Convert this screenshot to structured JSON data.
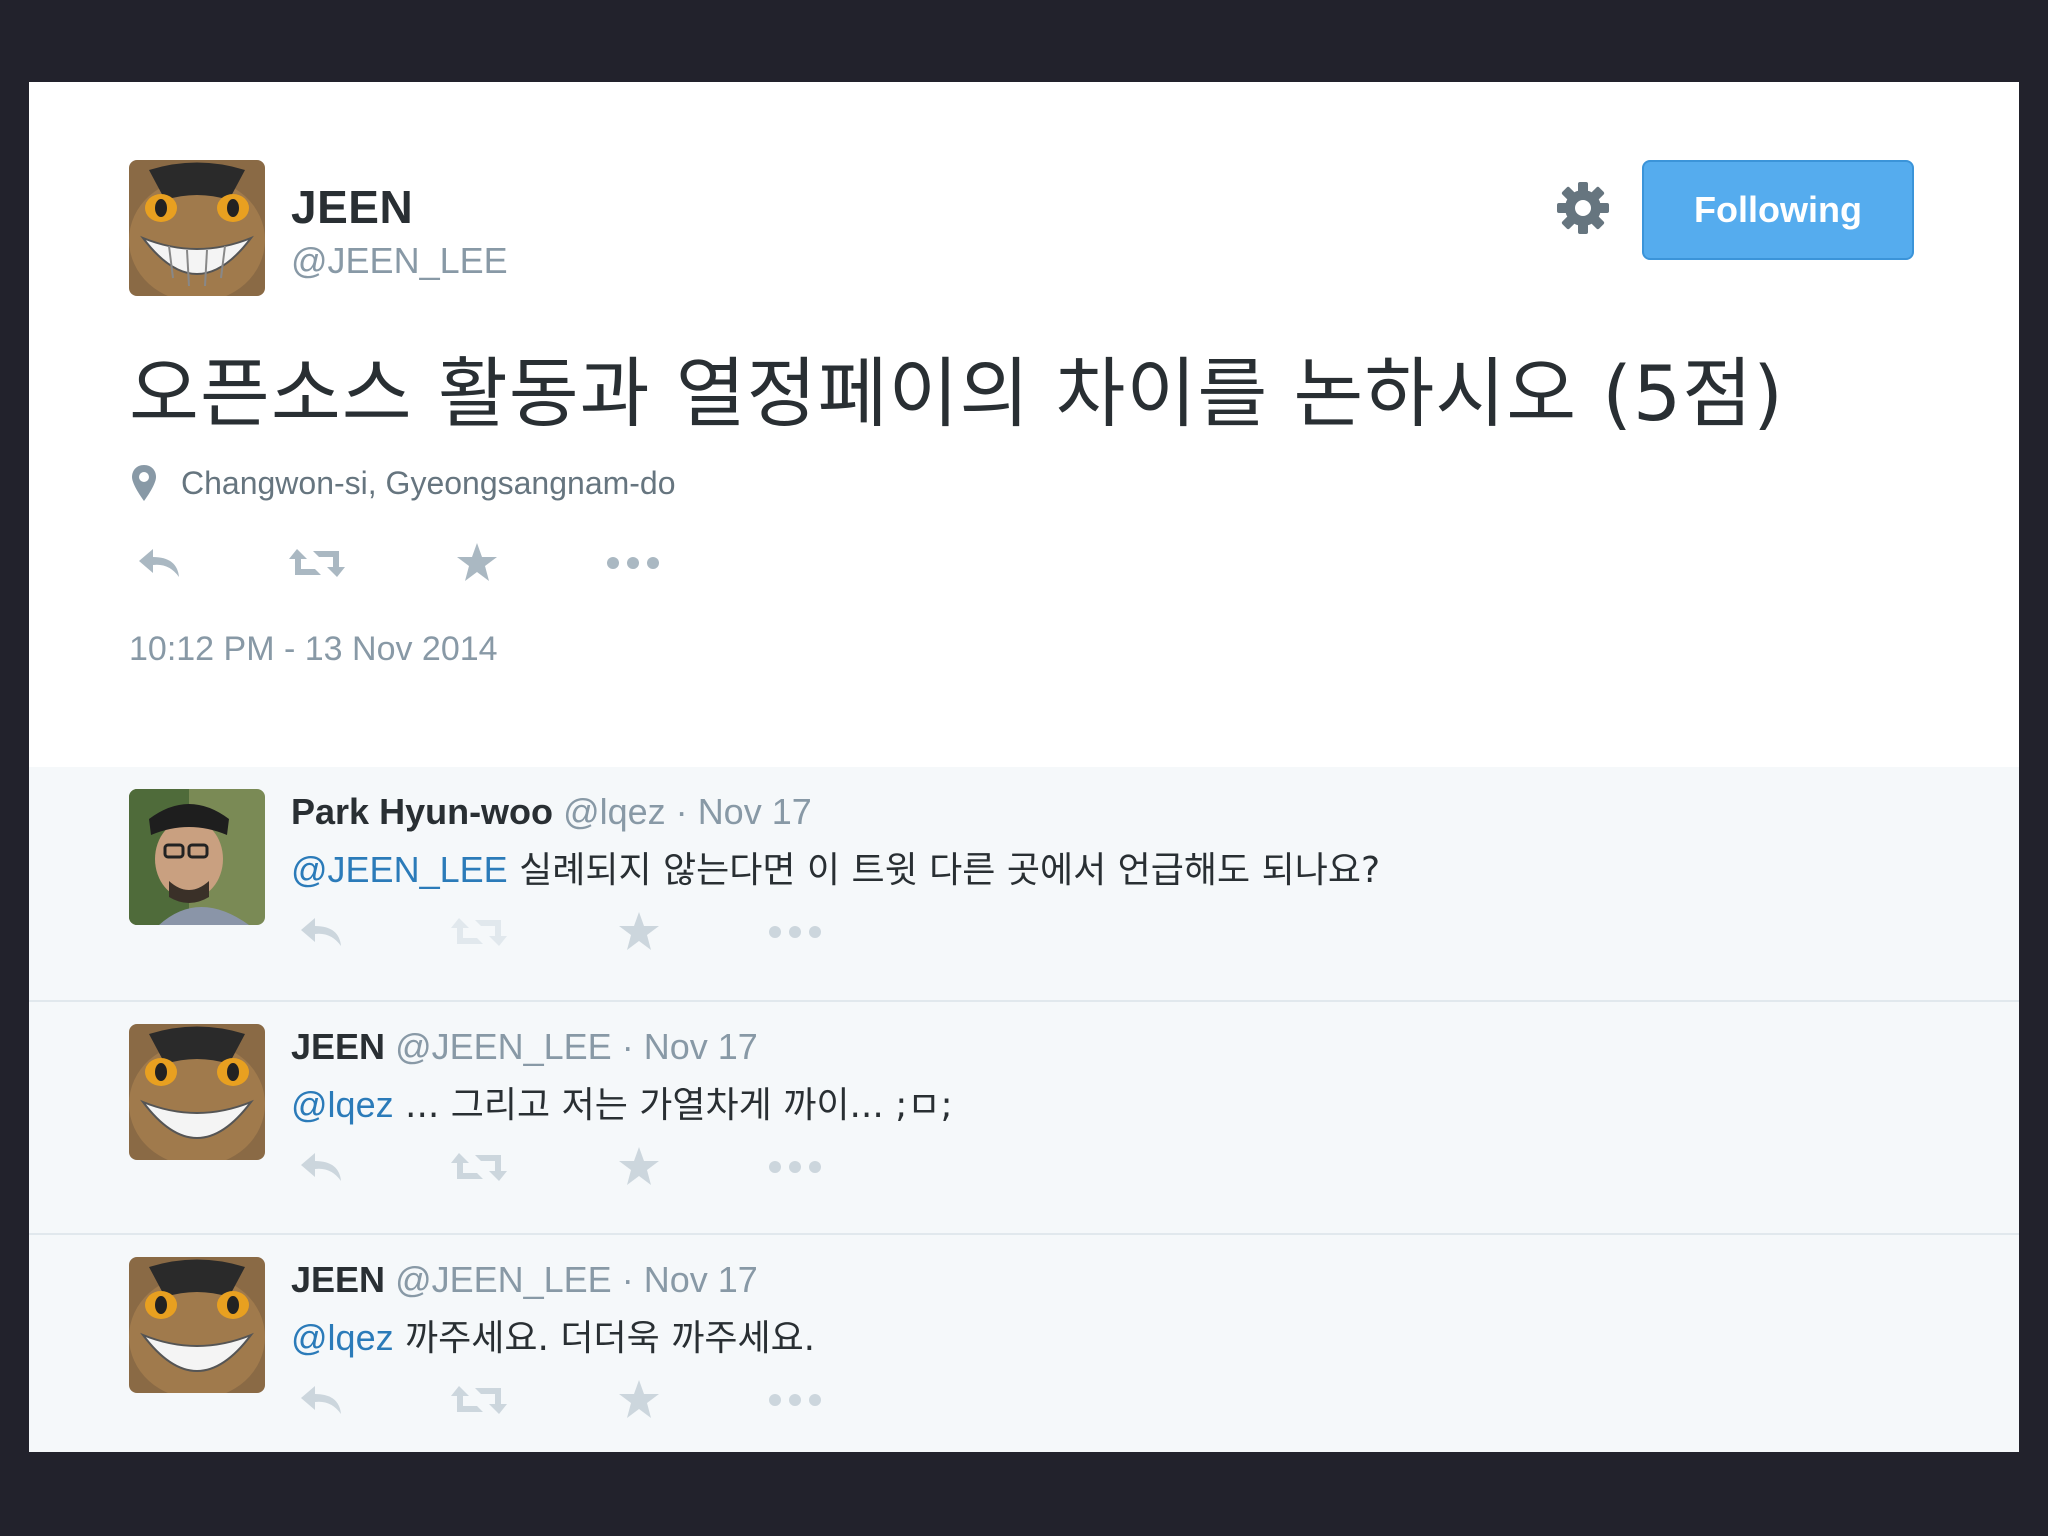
{
  "main_tweet": {
    "author_name": "JEEN",
    "author_handle": "@JEEN_LEE",
    "follow_button_label": "Following",
    "text": "오픈소스 활동과 열정페이의 차이를 논하시오 (5점)",
    "location": "Changwon-si, Gyeongsangnam-do",
    "timestamp": "10:12 PM - 13 Nov 2014",
    "actions": [
      "reply-icon",
      "retweet-icon",
      "favorite-icon",
      "more-icon"
    ]
  },
  "replies": [
    {
      "name": "Park Hyun-woo",
      "handle": "@lqez",
      "separator": "·",
      "date": "Nov 17",
      "mention": "@JEEN_LEE",
      "text": " 실례되지 않는다면 이 트윗 다른 곳에서 언급해도 되나요?"
    },
    {
      "name": "JEEN",
      "handle": "@JEEN_LEE",
      "separator": "·",
      "date": "Nov 17",
      "mention": "@lqez",
      "text": " ... 그리고 저는 가열차게 까이... ;ㅁ;"
    },
    {
      "name": "JEEN",
      "handle": "@JEEN_LEE",
      "separator": "·",
      "date": "Nov 17",
      "mention": "@lqez",
      "text": " 까주세요. 더더욱 까주세요."
    }
  ],
  "colors": {
    "accent": "#55acee",
    "mention": "#2b7bb9",
    "muted": "#8899a6",
    "text": "#292f33",
    "reply_bg": "#f5f8fa"
  }
}
